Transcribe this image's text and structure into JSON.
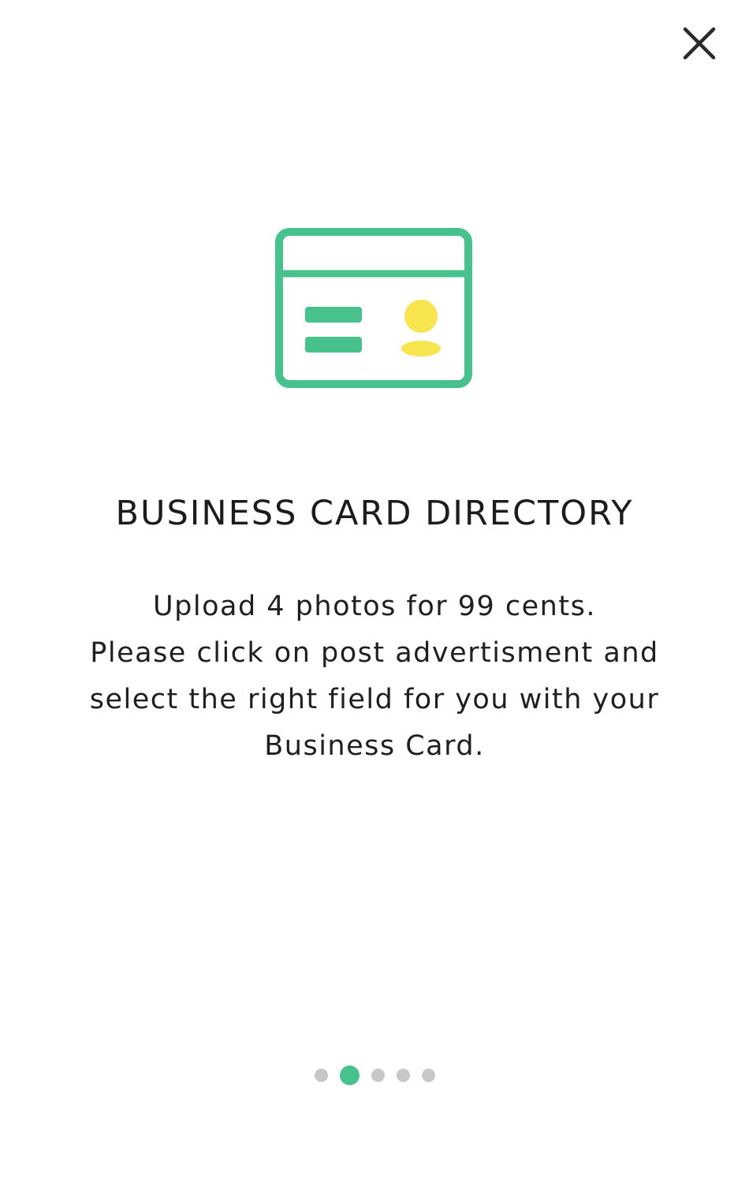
{
  "close": {
    "icon": "close-icon"
  },
  "illustration": {
    "icon": "business-card-icon",
    "colors": {
      "frame": "#47c28d",
      "person": "#f8e44e"
    }
  },
  "title": "BUSINESS CARD DIRECTORY",
  "description": {
    "lines": [
      "Upload 4 photos for 99 cents.",
      "Please click on post advertisment and",
      "select the right field for you with your",
      "Business Card."
    ]
  },
  "pager": {
    "total": 5,
    "current": 2,
    "active_color": "#47c28d",
    "inactive_color": "#c7c7c7"
  }
}
